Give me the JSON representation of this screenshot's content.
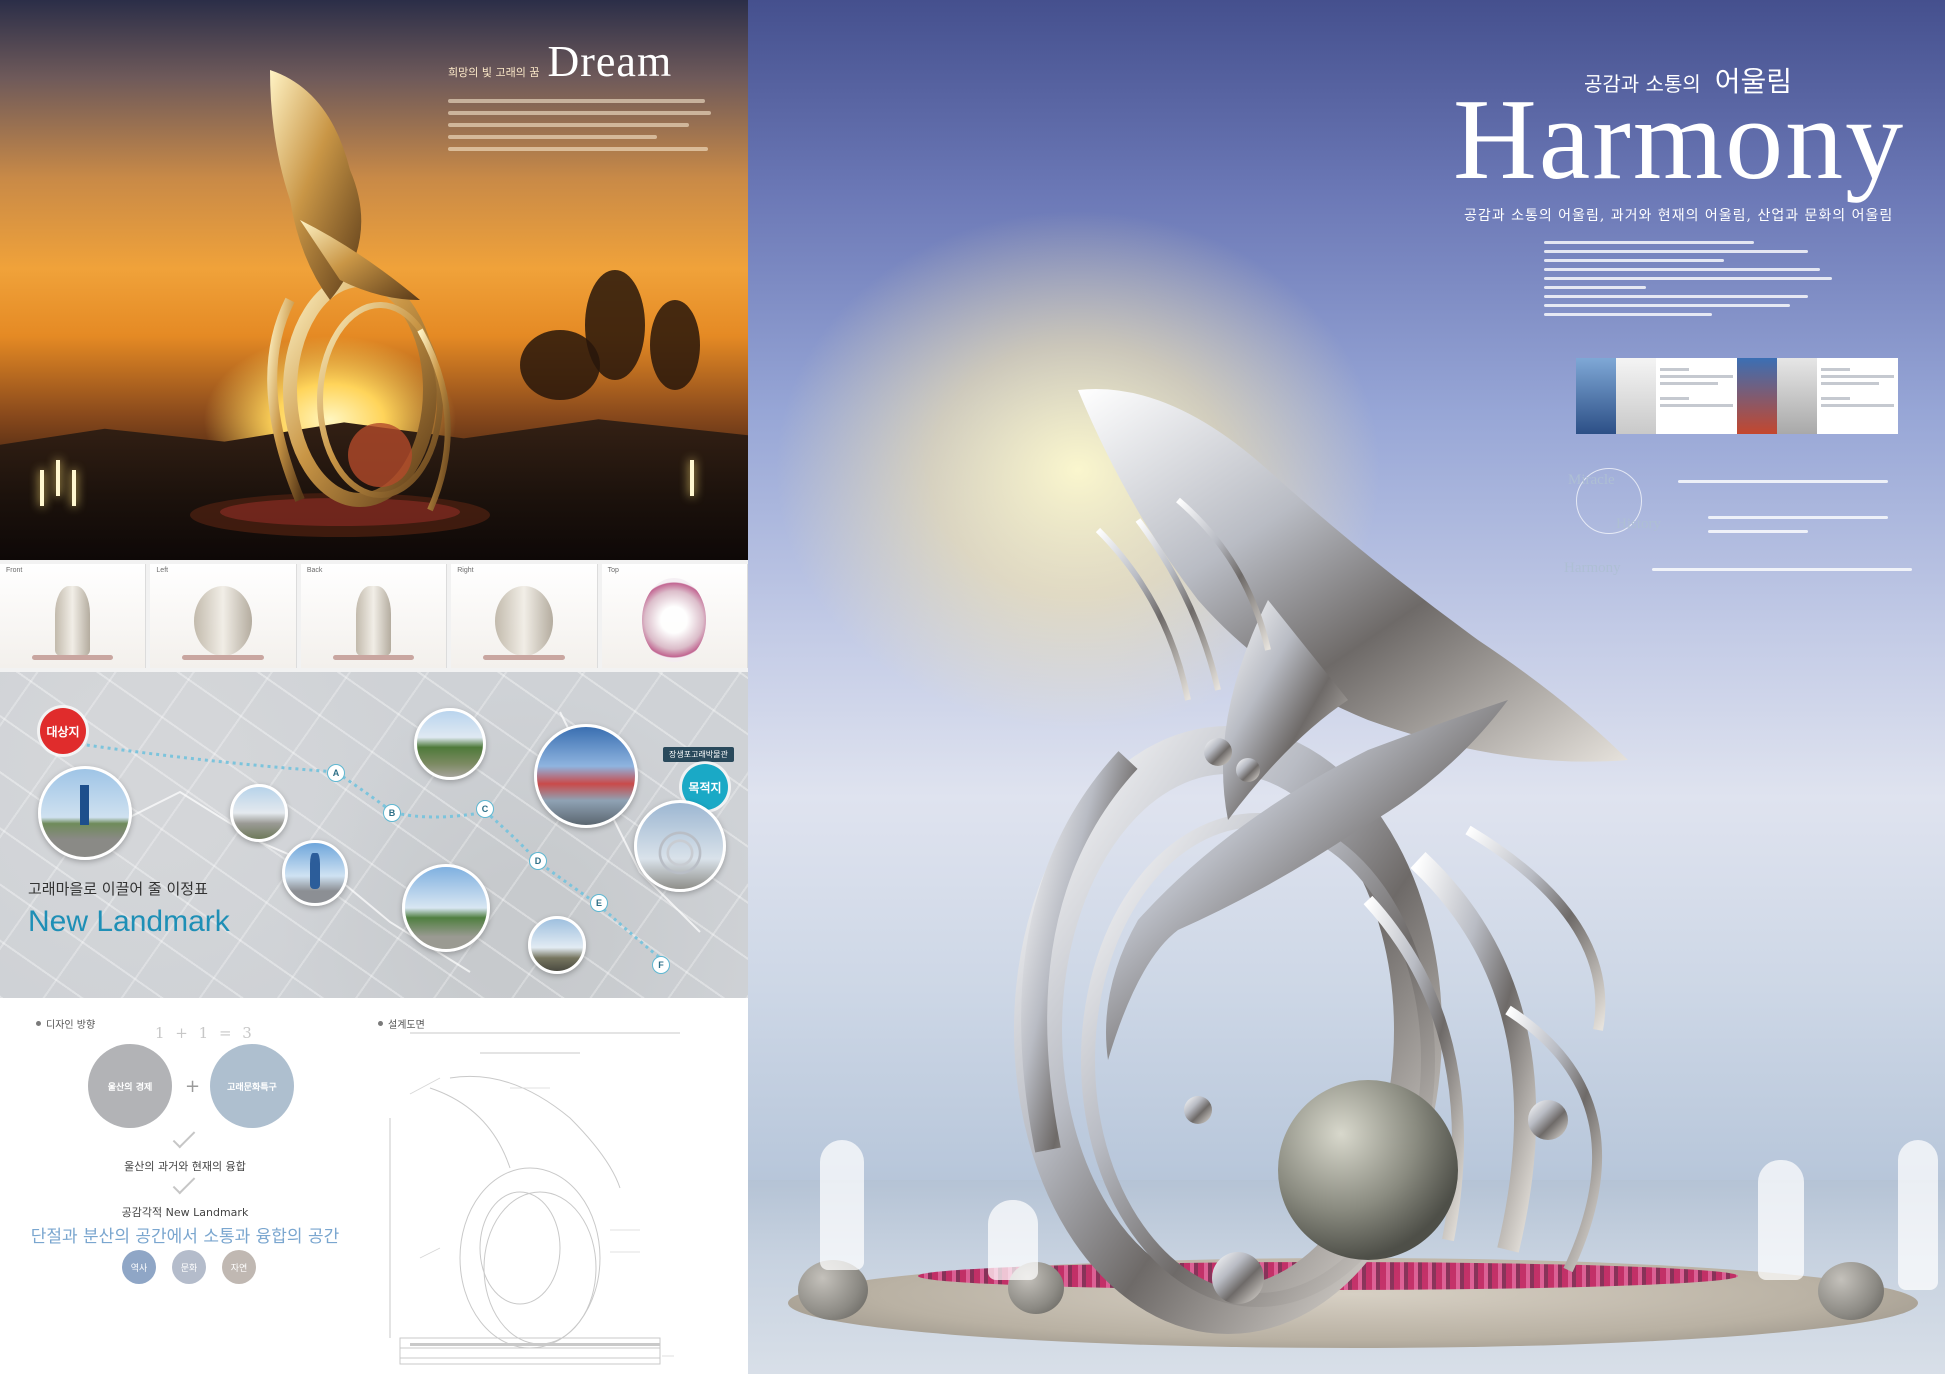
{
  "left_page": {
    "dream": {
      "subtitle": "희망의 빛 고래의 꿈",
      "title": "Dream"
    },
    "views": [
      {
        "label": "Front"
      },
      {
        "label": "Left"
      },
      {
        "label": "Back"
      },
      {
        "label": "Right"
      },
      {
        "label": "Top"
      }
    ],
    "map": {
      "start_label": "대상지",
      "end_label": "목적지",
      "end_tag": "장생포고래박물관",
      "pins": [
        "A",
        "B",
        "C",
        "D",
        "E",
        "F"
      ],
      "kicker": "고래마을로 이끌어 줄 이정표",
      "title": "New Landmark"
    },
    "concept": {
      "heading": "디자인 방향",
      "formula": "1 + 1 = 3",
      "bubble_left": "울산의 경제",
      "bubble_right": "고래문화특구",
      "plus": "+",
      "merge_line": "울산의 과거와 현재의 융합",
      "landmark_line": "공감각적 New Landmark",
      "big_line": "단절과 분산의 공간에서  소통과 융합의 공간",
      "small_bubbles": [
        "역사",
        "문화",
        "자연"
      ]
    },
    "drawing": {
      "heading": "설계도면"
    }
  },
  "right_page": {
    "subtitle_small": "공감과 소통의",
    "subtitle_big": "어울림",
    "title": "Harmony",
    "tagline": "공감과 소통의 어울림, 과거와 현재의 어울림, 산업과 문화의 어울림",
    "keywords": [
      "Miracle",
      "History",
      "Harmony"
    ]
  },
  "colors": {
    "accent_blue": "#1e8fb6",
    "start_red": "#e02c2c",
    "end_cyan": "#1aa9c6"
  }
}
